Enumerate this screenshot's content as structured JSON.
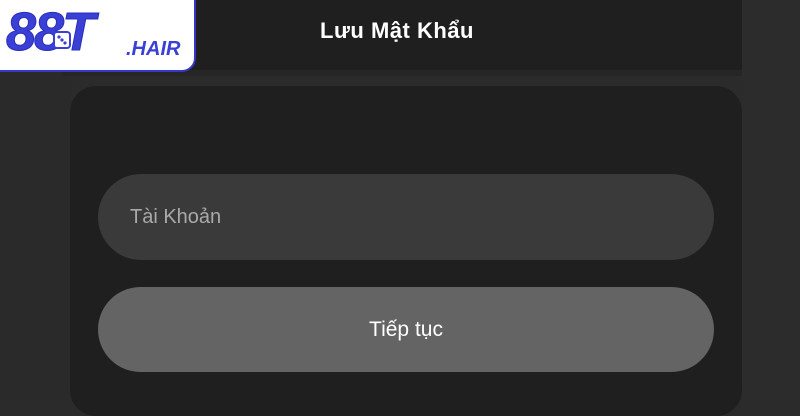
{
  "logo": {
    "main_text": "88T",
    "tld_text": ".HAIR",
    "brand_color": "#3a3fd6"
  },
  "header": {
    "title": "Lưu Mật Khẩu"
  },
  "form": {
    "account_placeholder": "Tài Khoản",
    "account_value": "",
    "continue_label": "Tiếp tục"
  },
  "colors": {
    "background": "#2b2b2b",
    "panel": "#1f1f1f",
    "input": "#3a3a3a",
    "button": "#646464"
  }
}
